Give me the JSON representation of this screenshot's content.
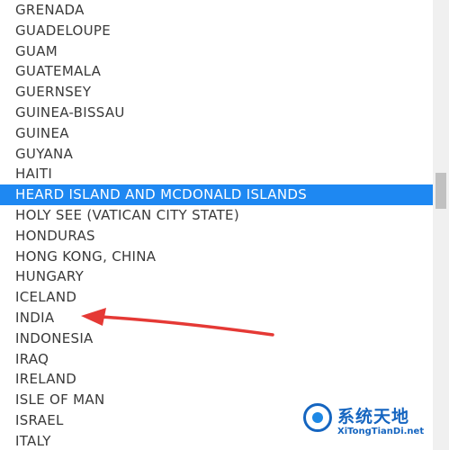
{
  "listbox": {
    "options": [
      "GRENADA",
      "GUADELOUPE",
      "GUAM",
      "GUATEMALA",
      "GUERNSEY",
      "GUINEA-BISSAU",
      "GUINEA",
      "GUYANA",
      "HAITI",
      "HEARD ISLAND AND MCDONALD ISLANDS",
      "HOLY SEE (VATICAN CITY STATE)",
      "HONDURAS",
      "HONG KONG, CHINA",
      "HUNGARY",
      "ICELAND",
      "INDIA",
      "INDONESIA",
      "IRAQ",
      "IRELAND",
      "ISLE OF MAN",
      "ISRAEL",
      "ITALY"
    ],
    "selected_index": 9,
    "selected_color": "#1e88f2"
  },
  "annotation": {
    "type": "red-arrow",
    "points_to": "INDIA",
    "color": "#e53935"
  },
  "watermark": {
    "logo": "system-heaven-logo-icon",
    "text_cn": "系统天地",
    "text_en": "XiTongTianDi.net"
  }
}
